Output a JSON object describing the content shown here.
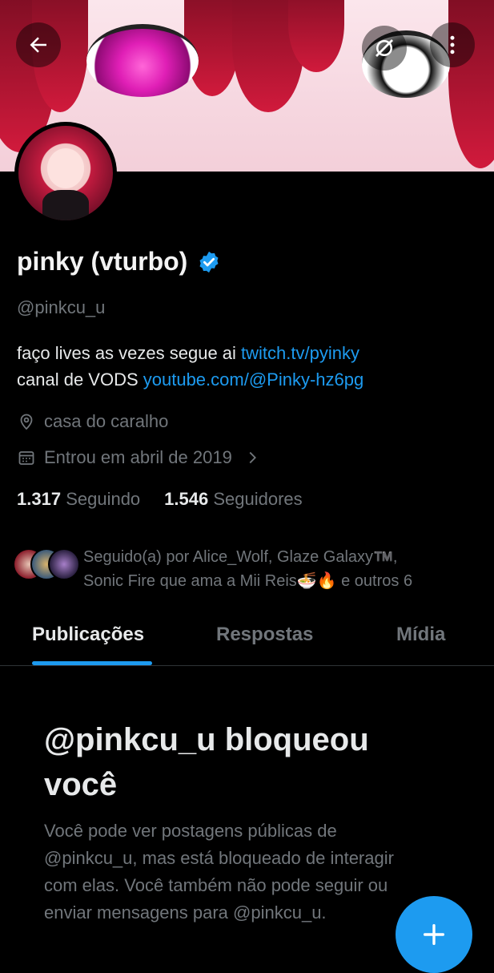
{
  "header": {
    "back_icon": "arrow-left-icon",
    "unfollow_icon": "slashed-circle-icon",
    "more_icon": "vertical-dots-icon"
  },
  "profile": {
    "display_name": "pinky (vturbo)",
    "verified_icon": "verified-badge-icon",
    "handle": "@pinkcu_u",
    "bio_line1_text": "faço lives as vezes segue ai ",
    "bio_line1_link": "twitch.tv/pyinky",
    "bio_line2_text": "canal de VODS ",
    "bio_line2_link": "youtube.com/@Pinky-hz6pg",
    "location": "casa do caralho",
    "joined": "Entrou em abril de 2019",
    "following_count": "1.317",
    "following_label": "Seguindo",
    "followers_count": "1.546",
    "followers_label": "Seguidores",
    "followed_by_line1": "Seguido(a) por Alice_Wolf, Glaze Galaxy™️,",
    "followed_by_line2": "Sonic Fire que ama a Mii Reis🍜🔥 e outros 6"
  },
  "tabs": [
    {
      "label": "Publicações",
      "active": true
    },
    {
      "label": "Respostas",
      "active": false
    },
    {
      "label": "Mídia",
      "active": false
    }
  ],
  "blocked": {
    "title": "@pinkcu_u bloqueou você",
    "message": "Você pode ver postagens públicas de @pinkcu_u, mas está bloqueado de interagir com elas. Você também não pode seguir ou enviar mensagens para @pinkcu_u."
  },
  "colors": {
    "accent": "#1d9bf0",
    "background": "#000000",
    "secondary_text": "#71767b"
  }
}
